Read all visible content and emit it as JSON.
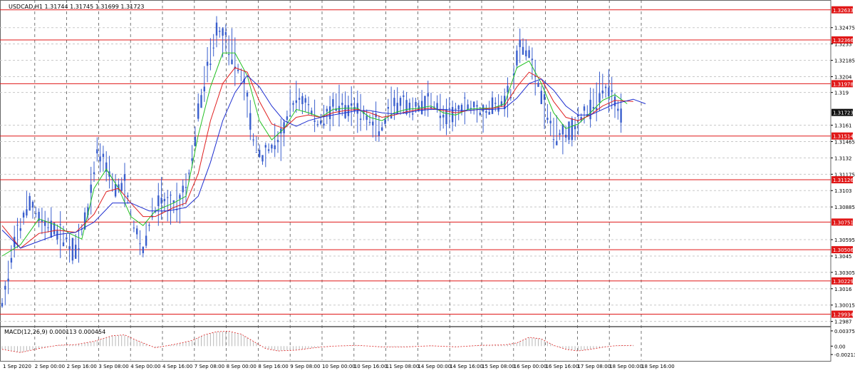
{
  "header": {
    "symbol_label": "USDCAD,H1  1.31744 1.31745 1.31699 1.31723"
  },
  "macd": {
    "label": "MACD(12,26,9) 0.000113 0.000454",
    "tick_labels": [
      "0.003755",
      "0.00",
      "-0.002135"
    ]
  },
  "colors": {
    "candles": "#3a5fcd",
    "ma_fast": "#22c022",
    "ma_mid": "#e02020",
    "ma_slow": "#1f2fd0",
    "levels": "#e01818",
    "grid": "#c8c8c8",
    "separators": "#555555",
    "price_tag": "#111111",
    "macd_hist": "#b8b8b8",
    "macd_signal": "#e02020"
  },
  "chart_data": {
    "type": "line",
    "symbol": "USDCAD",
    "timeframe": "H1",
    "ylim": [
      1.2983,
      1.3272
    ],
    "current_price": 1.31723,
    "y_ticks": [
      1.32475,
      1.3233,
      1.32185,
      1.3204,
      1.319,
      1.3161,
      1.31465,
      1.3132,
      1.31175,
      1.3103,
      1.30885,
      1.30595,
      1.3045,
      1.30305,
      1.3016,
      1.30015,
      1.2987
    ],
    "x_labels": [
      "1 Sep 2020",
      "2 Sep 00:00",
      "2 Sep 16:00",
      "3 Sep 08:00",
      "4 Sep 00:00",
      "4 Sep 16:00",
      "7 Sep 08:00",
      "8 Sep 00:00",
      "8 Sep 16:00",
      "9 Sep 08:00",
      "10 Sep 00:00",
      "10 Sep 16:00",
      "11 Sep 08:00",
      "14 Sep 00:00",
      "14 Sep 16:00",
      "15 Sep 08:00",
      "16 Sep 00:00",
      "16 Sep 16:00",
      "17 Sep 08:00",
      "18 Sep 00:00",
      "18 Sep 16:00"
    ],
    "levels": [
      1.32633,
      1.32366,
      1.31978,
      1.31514,
      1.31126,
      1.30751,
      1.30506,
      1.30229,
      1.29934
    ],
    "price_path": [
      [
        0,
        1.3002
      ],
      [
        5,
        1.3065
      ],
      [
        9,
        1.3092
      ],
      [
        13,
        1.3075
      ],
      [
        17,
        1.3068
      ],
      [
        21,
        1.306
      ],
      [
        24,
        1.3048
      ],
      [
        28,
        1.3085
      ],
      [
        31,
        1.3138
      ],
      [
        34,
        1.3128
      ],
      [
        37,
        1.3105
      ],
      [
        40,
        1.3108
      ],
      [
        43,
        1.3072
      ],
      [
        46,
        1.305
      ],
      [
        49,
        1.3082
      ],
      [
        52,
        1.3095
      ],
      [
        55,
        1.3088
      ],
      [
        58,
        1.3093
      ],
      [
        61,
        1.3115
      ],
      [
        64,
        1.3172
      ],
      [
        67,
        1.3212
      ],
      [
        70,
        1.3245
      ],
      [
        73,
        1.3238
      ],
      [
        76,
        1.3218
      ],
      [
        79,
        1.3198
      ],
      [
        82,
        1.3148
      ],
      [
        85,
        1.3132
      ],
      [
        88,
        1.3142
      ],
      [
        91,
        1.3148
      ],
      [
        94,
        1.3175
      ],
      [
        97,
        1.3185
      ],
      [
        100,
        1.3178
      ],
      [
        103,
        1.3162
      ],
      [
        106,
        1.3172
      ],
      [
        109,
        1.3178
      ],
      [
        112,
        1.3175
      ],
      [
        115,
        1.3178
      ],
      [
        118,
        1.317
      ],
      [
        121,
        1.3162
      ],
      [
        124,
        1.3158
      ],
      [
        127,
        1.3176
      ],
      [
        130,
        1.318
      ],
      [
        133,
        1.3175
      ],
      [
        136,
        1.3178
      ],
      [
        139,
        1.3183
      ],
      [
        142,
        1.3178
      ],
      [
        145,
        1.3165
      ],
      [
        148,
        1.3172
      ],
      [
        151,
        1.3178
      ],
      [
        154,
        1.3178
      ],
      [
        157,
        1.3172
      ],
      [
        160,
        1.3178
      ],
      [
        163,
        1.3182
      ],
      [
        166,
        1.3188
      ],
      [
        169,
        1.3232
      ],
      [
        172,
        1.3225
      ],
      [
        175,
        1.3198
      ],
      [
        178,
        1.3168
      ],
      [
        181,
        1.3152
      ],
      [
        184,
        1.3155
      ],
      [
        187,
        1.316
      ],
      [
        190,
        1.3172
      ],
      [
        193,
        1.3178
      ],
      [
        196,
        1.3195
      ],
      [
        199,
        1.3188
      ],
      [
        202,
        1.3172
      ]
    ],
    "ma_fast": [
      [
        0,
        1.3045
      ],
      [
        6,
        1.3055
      ],
      [
        12,
        1.3078
      ],
      [
        18,
        1.3072
      ],
      [
        22,
        1.3065
      ],
      [
        26,
        1.306
      ],
      [
        30,
        1.3105
      ],
      [
        34,
        1.3122
      ],
      [
        38,
        1.3105
      ],
      [
        42,
        1.308
      ],
      [
        46,
        1.3072
      ],
      [
        50,
        1.3085
      ],
      [
        56,
        1.3092
      ],
      [
        60,
        1.3098
      ],
      [
        64,
        1.3152
      ],
      [
        68,
        1.3195
      ],
      [
        72,
        1.3225
      ],
      [
        76,
        1.3225
      ],
      [
        80,
        1.3205
      ],
      [
        84,
        1.3165
      ],
      [
        88,
        1.3148
      ],
      [
        92,
        1.3158
      ],
      [
        96,
        1.3175
      ],
      [
        100,
        1.3172
      ],
      [
        104,
        1.3168
      ],
      [
        108,
        1.3175
      ],
      [
        112,
        1.3176
      ],
      [
        116,
        1.3176
      ],
      [
        120,
        1.3168
      ],
      [
        124,
        1.3165
      ],
      [
        128,
        1.3172
      ],
      [
        132,
        1.3175
      ],
      [
        136,
        1.3176
      ],
      [
        140,
        1.3178
      ],
      [
        144,
        1.3172
      ],
      [
        148,
        1.317
      ],
      [
        152,
        1.3175
      ],
      [
        156,
        1.3176
      ],
      [
        160,
        1.3176
      ],
      [
        164,
        1.318
      ],
      [
        168,
        1.3212
      ],
      [
        172,
        1.3218
      ],
      [
        176,
        1.3198
      ],
      [
        180,
        1.3172
      ],
      [
        184,
        1.3158
      ],
      [
        188,
        1.3162
      ],
      [
        192,
        1.3172
      ],
      [
        196,
        1.3183
      ],
      [
        200,
        1.3188
      ],
      [
        204,
        1.318
      ]
    ],
    "ma_mid": [
      [
        0,
        1.3072
      ],
      [
        6,
        1.3052
      ],
      [
        12,
        1.3065
      ],
      [
        18,
        1.3068
      ],
      [
        24,
        1.3066
      ],
      [
        30,
        1.3082
      ],
      [
        34,
        1.3102
      ],
      [
        38,
        1.3105
      ],
      [
        42,
        1.3092
      ],
      [
        46,
        1.308
      ],
      [
        50,
        1.308
      ],
      [
        56,
        1.3088
      ],
      [
        60,
        1.3092
      ],
      [
        64,
        1.3118
      ],
      [
        68,
        1.3165
      ],
      [
        72,
        1.3198
      ],
      [
        76,
        1.3212
      ],
      [
        80,
        1.3208
      ],
      [
        84,
        1.3182
      ],
      [
        88,
        1.3162
      ],
      [
        92,
        1.3158
      ],
      [
        96,
        1.3168
      ],
      [
        100,
        1.317
      ],
      [
        104,
        1.3168
      ],
      [
        108,
        1.3172
      ],
      [
        112,
        1.3174
      ],
      [
        116,
        1.3175
      ],
      [
        120,
        1.3172
      ],
      [
        124,
        1.3168
      ],
      [
        128,
        1.317
      ],
      [
        132,
        1.3173
      ],
      [
        136,
        1.3175
      ],
      [
        140,
        1.3176
      ],
      [
        144,
        1.3174
      ],
      [
        148,
        1.3172
      ],
      [
        152,
        1.3174
      ],
      [
        156,
        1.3175
      ],
      [
        160,
        1.3176
      ],
      [
        164,
        1.3178
      ],
      [
        168,
        1.3195
      ],
      [
        172,
        1.3208
      ],
      [
        176,
        1.3202
      ],
      [
        180,
        1.3182
      ],
      [
        184,
        1.3168
      ],
      [
        188,
        1.3165
      ],
      [
        192,
        1.317
      ],
      [
        196,
        1.3178
      ],
      [
        200,
        1.3183
      ],
      [
        206,
        1.3182
      ]
    ],
    "ma_slow": [
      [
        0,
        1.3068
      ],
      [
        6,
        1.3052
      ],
      [
        12,
        1.3058
      ],
      [
        18,
        1.3064
      ],
      [
        24,
        1.3066
      ],
      [
        30,
        1.3075
      ],
      [
        36,
        1.3092
      ],
      [
        42,
        1.3092
      ],
      [
        48,
        1.3085
      ],
      [
        54,
        1.3085
      ],
      [
        60,
        1.3088
      ],
      [
        64,
        1.3098
      ],
      [
        68,
        1.3128
      ],
      [
        72,
        1.3165
      ],
      [
        76,
        1.319
      ],
      [
        80,
        1.3205
      ],
      [
        84,
        1.3195
      ],
      [
        88,
        1.3178
      ],
      [
        92,
        1.3165
      ],
      [
        96,
        1.316
      ],
      [
        100,
        1.3165
      ],
      [
        104,
        1.3168
      ],
      [
        108,
        1.317
      ],
      [
        112,
        1.3172
      ],
      [
        116,
        1.3174
      ],
      [
        120,
        1.3174
      ],
      [
        124,
        1.3172
      ],
      [
        128,
        1.3171
      ],
      [
        132,
        1.3172
      ],
      [
        136,
        1.3174
      ],
      [
        140,
        1.3175
      ],
      [
        144,
        1.3175
      ],
      [
        148,
        1.3174
      ],
      [
        152,
        1.3174
      ],
      [
        156,
        1.3175
      ],
      [
        160,
        1.3175
      ],
      [
        164,
        1.3176
      ],
      [
        168,
        1.3185
      ],
      [
        172,
        1.3198
      ],
      [
        176,
        1.3202
      ],
      [
        180,
        1.3192
      ],
      [
        184,
        1.3178
      ],
      [
        188,
        1.317
      ],
      [
        192,
        1.317
      ],
      [
        196,
        1.3175
      ],
      [
        200,
        1.318
      ],
      [
        206,
        1.3184
      ],
      [
        210,
        1.318
      ]
    ],
    "macd_histogram": [
      [
        0,
        -0.0008
      ],
      [
        6,
        -0.0016
      ],
      [
        12,
        -0.0006
      ],
      [
        18,
        0.0002
      ],
      [
        24,
        0.0004
      ],
      [
        30,
        0.0012
      ],
      [
        36,
        0.0026
      ],
      [
        40,
        0.0028
      ],
      [
        44,
        0.0014
      ],
      [
        50,
        -0.0004
      ],
      [
        56,
        0.0004
      ],
      [
        62,
        0.0014
      ],
      [
        66,
        0.0028
      ],
      [
        70,
        0.0036
      ],
      [
        74,
        0.0037
      ],
      [
        78,
        0.003
      ],
      [
        82,
        0.0012
      ],
      [
        86,
        -0.0006
      ],
      [
        90,
        -0.0012
      ],
      [
        96,
        -0.001
      ],
      [
        102,
        -0.0004
      ],
      [
        108,
        0.0
      ],
      [
        116,
        0.0002
      ],
      [
        124,
        -0.0002
      ],
      [
        132,
        -0.0002
      ],
      [
        140,
        0.0001
      ],
      [
        148,
        -0.0002
      ],
      [
        156,
        0.0002
      ],
      [
        164,
        0.0003
      ],
      [
        168,
        0.0008
      ],
      [
        172,
        0.0022
      ],
      [
        176,
        0.0018
      ],
      [
        180,
        0.0002
      ],
      [
        184,
        -0.0008
      ],
      [
        188,
        -0.0012
      ],
      [
        192,
        -0.0008
      ],
      [
        196,
        -0.0003
      ],
      [
        200,
        0.0001
      ],
      [
        206,
        0.0002
      ]
    ],
    "macd_ylim": [
      -0.0035,
      0.0045
    ]
  }
}
